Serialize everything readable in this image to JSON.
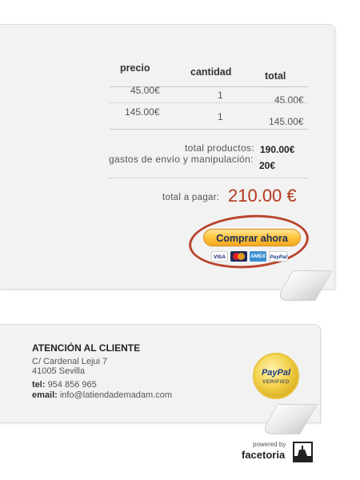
{
  "order": {
    "headers": {
      "precio": "precio",
      "cantidad": "cantidad",
      "total": "total"
    },
    "items": [
      {
        "precio": "45.00€",
        "cantidad": "1",
        "total": "45.00€"
      },
      {
        "precio": "145.00€",
        "cantidad": "1",
        "total": "145.00€"
      }
    ],
    "subtotal": {
      "label": "total productos:",
      "value": "190.00€"
    },
    "shipping": {
      "label": "gastos de envío y manipulación:",
      "value": "20€"
    },
    "grand_total": {
      "label": "total a pagar:",
      "value": "210.00 €"
    },
    "buy_button": "Comprar ahora",
    "cards": [
      {
        "name": "VISA",
        "icon": "visa-card-icon"
      },
      {
        "name": "",
        "icon": "mastercard-icon"
      },
      {
        "name": "AMEX",
        "icon": "amex-card-icon"
      },
      {
        "name": "PayPal",
        "icon": "paypal-card-icon"
      }
    ]
  },
  "contact": {
    "title": "ATENCIÓN AL CLIENTE",
    "address_line1": "C/ Cardenal Lejui 7",
    "address_line2": "41005 Sevilla",
    "tel_label": "tel:",
    "tel_value": "954 856 965",
    "email_label": "email:",
    "email_value": "info@latiendademadam.com"
  },
  "badge": {
    "top": "PayPal",
    "bottom": "VERIFIED"
  },
  "footer": {
    "powered_by": "powered by",
    "brand": "facetoria"
  },
  "colors": {
    "total_red": "#b5361a",
    "circle_red": "#b8452c",
    "button_gold": "#ffc439",
    "card_bg": "#f2f2f2"
  }
}
